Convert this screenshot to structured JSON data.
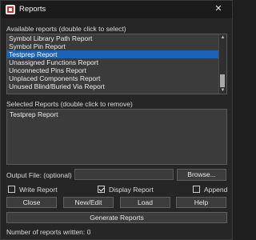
{
  "window": {
    "title": "Reports",
    "close_glyph": "✕"
  },
  "available": {
    "label": "Available reports (double click to select)",
    "items": [
      {
        "label": "Symbol Library Path Report",
        "selected": false
      },
      {
        "label": "Symbol Pin Report",
        "selected": false
      },
      {
        "label": "Testprep Report",
        "selected": true
      },
      {
        "label": "Unassigned Functions Report",
        "selected": false
      },
      {
        "label": "Unconnected Pins Report",
        "selected": false
      },
      {
        "label": "Unplaced Components Report",
        "selected": false
      },
      {
        "label": "Unused Blind/Buried Via Report",
        "selected": false
      }
    ]
  },
  "selected_reports": {
    "label": "Selected Reports (double click to remove)",
    "items": [
      "Testprep Report"
    ]
  },
  "output": {
    "label": "Output File: (optional)",
    "value": "",
    "browse_label": "Browse..."
  },
  "options": {
    "write_report": {
      "label": "Write Report",
      "checked": false
    },
    "display_report": {
      "label": "Display Report",
      "checked": true
    },
    "append": {
      "label": "Append",
      "checked": false
    }
  },
  "buttons": {
    "close": "Close",
    "new_edit": "New/Edit",
    "load": "Load",
    "help": "Help",
    "generate": "Generate Reports"
  },
  "status": {
    "reports_written": "Number of reports written: 0"
  },
  "colors": {
    "selection": "#1565c0",
    "background": "#262626",
    "field": "#3b3b3b"
  }
}
